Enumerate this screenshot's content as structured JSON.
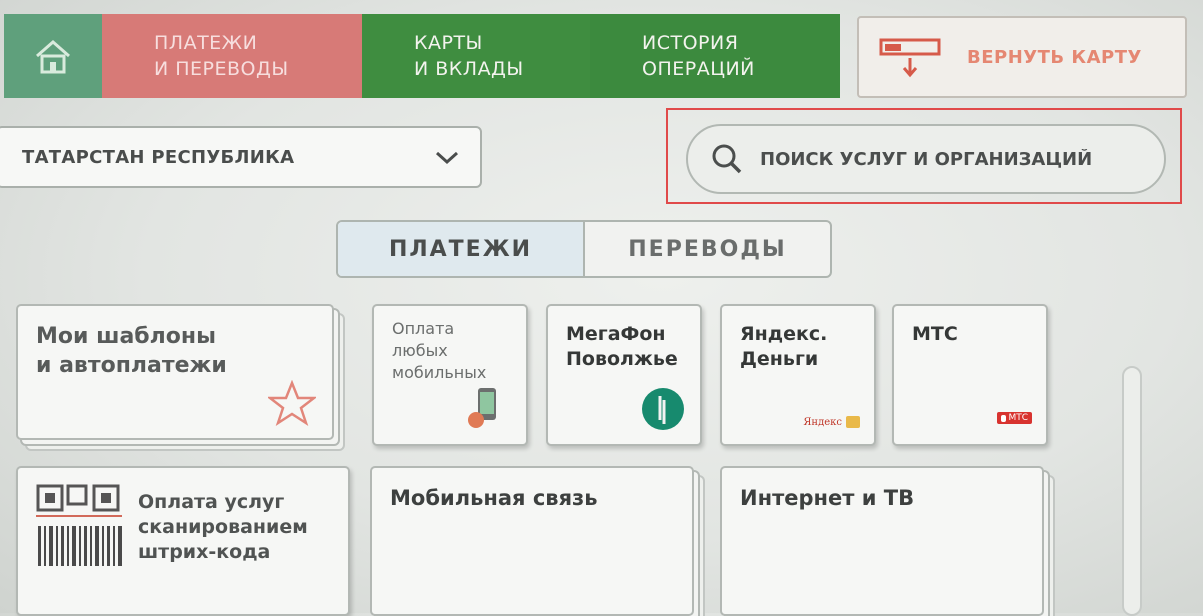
{
  "nav": {
    "home_icon": "home-icon",
    "tabs": [
      {
        "label": "ПЛАТЕЖИ\nИ ПЕРЕВОДЫ"
      },
      {
        "label": "КАРТЫ\nИ ВКЛАДЫ"
      },
      {
        "label": "ИСТОРИЯ\nОПЕРАЦИЙ"
      }
    ],
    "return_card": {
      "label": "ВЕРНУТЬ КАРТУ",
      "icon": "card-return-icon"
    }
  },
  "region": {
    "value": "ТАТАРСТАН РЕСПУБЛИКА",
    "icon": "chevron-down-icon"
  },
  "search": {
    "placeholder": "ПОИСК УСЛУГ И ОРГАНИЗАЦИЙ",
    "icon": "search-icon"
  },
  "segment": {
    "payments": "ПЛАТЕЖИ",
    "transfers": "ПЕРЕВОДЫ",
    "selected": "ПЛАТЕЖИ"
  },
  "tiles": {
    "templates": {
      "label": "Мои шаблоны\nи автоплатежи",
      "icon": "star-icon"
    },
    "any_mobile": {
      "label": "Оплата\nлюбых\nмобильных",
      "icon": "phone-icon"
    },
    "megafon": {
      "label": "МегаФон\nПоволжье",
      "icon": "megafon-logo-icon"
    },
    "yandex": {
      "label": "Яндекс.\nДеньги",
      "logo_text": "Яндекс",
      "icon": "yandex-money-logo-icon"
    },
    "mts": {
      "label": "МТС",
      "logo_text": "МТС",
      "icon": "mts-logo-icon"
    },
    "barcode": {
      "label": "Оплата услуг\nсканированием\nштрих-кода",
      "icon": "barcode-icon"
    },
    "mobile": {
      "label": "Мобильная связь"
    },
    "internet": {
      "label": "Интернет и ТВ"
    }
  },
  "colors": {
    "green": "#3f8d40",
    "active_tab": "#d77a77",
    "highlight": "#e04a4a",
    "accent_red": "#e58772"
  }
}
